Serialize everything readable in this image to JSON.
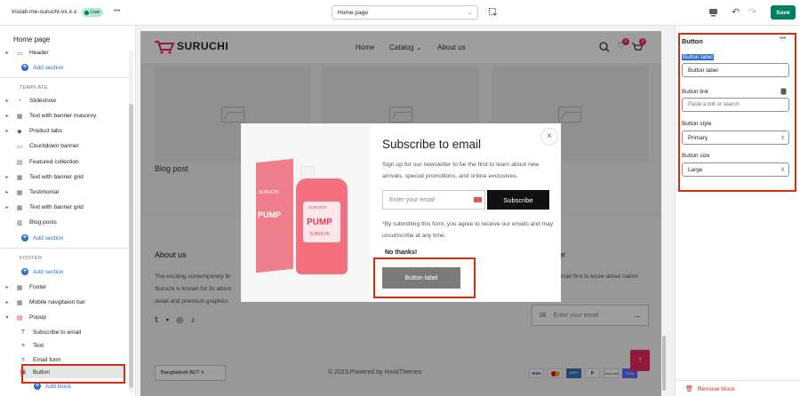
{
  "topbar": {
    "theme_name": "Install-me-suruchi-vx.x.x",
    "live_badge": "Live",
    "more": "•••",
    "page_select": "Home page",
    "save": "Save"
  },
  "sidebar": {
    "title": "Home page",
    "header_item": "Header",
    "add_section": "Add section",
    "template_label": "TEMPLATE",
    "template_items": [
      "Slideshow",
      "Text with banner masonry",
      "Product tabs",
      "Countdown banner",
      "Featured collection",
      "Text with banner grid",
      "Testimonial",
      "Text with banner grid",
      "Blog posts"
    ],
    "footer_label": "FOOTER",
    "footer_items": [
      "Footer",
      "Mobile navgitaion bar",
      "Popup"
    ],
    "popup_blocks": [
      "Subscribe to email",
      "Text",
      "Email form",
      "Button"
    ],
    "add_block": "Add block"
  },
  "store": {
    "logo": "SURUCHI",
    "nav": [
      "Home",
      "Catalog",
      "About us"
    ],
    "wishlist_count": "0",
    "cart_count": "0",
    "blog_post": "Blog post",
    "about_us": "About us",
    "about_text": "The exciting contemporary br Suruchi is known for its attent detail and premium graphics",
    "newsletter_partial": "tter",
    "newsletter_text": "r email first to know about nation",
    "footer_email_placeholder": "Enter your email",
    "currency": "Bangladesh BDT ৳",
    "copyright": "© 2023,Powered by HookThemes",
    "payments": [
      "VISA",
      "MC",
      "AMEX",
      "PayPal",
      "DISCOVER",
      "GPay"
    ]
  },
  "popup": {
    "title": "Subscribe to email",
    "text": "Sign up for our newsletter to be the first to learn about new arrivals, special promotions, and online exclusives.",
    "email_placeholder": "Enter your email",
    "subscribe": "Subscribe",
    "disclaimer": "*By submitting this form, you agree to receive our emails and may unsubscribe at any time.",
    "no_thanks": "No thanks!",
    "button_label": "Button label",
    "product_brand": "SURUCHI",
    "product_name": "PUMP",
    "product_sub": "SURUCHI"
  },
  "settings": {
    "title": "Button",
    "more": "•••",
    "button_label_label": "Button label",
    "button_label_value": "Button label",
    "button_link_label": "Button link",
    "button_link_placeholder": "Paste a link or search",
    "button_style_label": "Button style",
    "button_style_value": "Primary",
    "button_size_label": "Button size",
    "button_size_value": "Large",
    "remove_block": "Remove block"
  },
  "colors": {
    "accent": "#ee2761",
    "save": "#008060",
    "link": "#2c6ecb",
    "highlight": "#d72c0d"
  }
}
